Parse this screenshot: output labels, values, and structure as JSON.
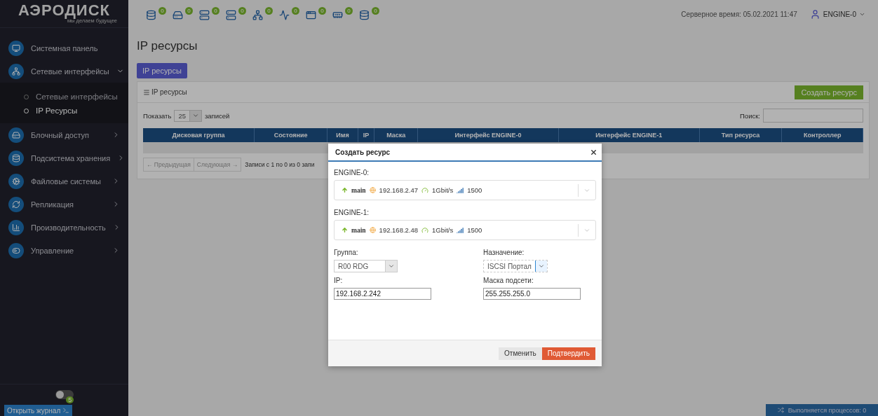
{
  "brand": {
    "name": "АЭРОДИСК",
    "tagline": "мы делаем будущее"
  },
  "status_icons": [
    {
      "kind": "database",
      "count": "0"
    },
    {
      "kind": "disk",
      "count": "0"
    },
    {
      "kind": "server",
      "count": "0"
    },
    {
      "kind": "server",
      "count": "0"
    },
    {
      "kind": "network",
      "count": "0"
    },
    {
      "kind": "pulse",
      "count": "0"
    },
    {
      "kind": "window",
      "count": "0"
    },
    {
      "kind": "memory",
      "count": "0"
    },
    {
      "kind": "database",
      "count": "0"
    }
  ],
  "header": {
    "server_time": "Серверное время: 05.02.2021 11:47",
    "user": "ENGINE-0"
  },
  "sidebar": {
    "items": [
      {
        "kind": "link",
        "label": "Системная панель"
      },
      {
        "kind": "group",
        "label": "Сетевые интерфейсы",
        "expanded": true,
        "children": [
          {
            "label": "Сетевые интерфейсы",
            "selected": false
          },
          {
            "label": "IP Ресурсы",
            "selected": true
          }
        ]
      },
      {
        "kind": "group",
        "label": "Блочный доступ",
        "expanded": false
      },
      {
        "kind": "group",
        "label": "Подсистема хранения",
        "expanded": false
      },
      {
        "kind": "group",
        "label": "Файловые системы",
        "expanded": false
      },
      {
        "kind": "group",
        "label": "Репликация",
        "expanded": false
      },
      {
        "kind": "group",
        "label": "Производительность",
        "expanded": false
      },
      {
        "kind": "group",
        "label": "Управление",
        "expanded": false
      }
    ],
    "toggle": {
      "on": false
    },
    "journal": {
      "label": "Открыть журнал",
      "count": "5"
    }
  },
  "page": {
    "title": "IP ресурсы",
    "tabs": [
      {
        "label": "IP ресурсы",
        "selected": true
      }
    ],
    "panel": {
      "title": "IP ресурсы",
      "create_button": "Создать ресурс",
      "show_label": "Показать",
      "page_size": "25",
      "entries_label": "записей",
      "search_label": "Поиск:",
      "columns": [
        "Дисковая группа",
        "Состояние",
        "Имя",
        "IP",
        "Маска",
        "Интерфейс ENGINE-0",
        "Интерфейс ENGINE-1",
        "Тип ресурса",
        "Контроллер"
      ],
      "prev": "← Предыдущая",
      "next": "Следующая →",
      "info": "Записи с 1 по 0 из 0 запи"
    }
  },
  "status_bar": "Выполняется процессов: 0",
  "dialog": {
    "title": "Создать ресурс",
    "engines": [
      {
        "label": "ENGINE-0:",
        "name": "main",
        "ip": "192.168.2.47",
        "speed": "1Gbit/s",
        "mtu": "1500"
      },
      {
        "label": "ENGINE-1:",
        "name": "main",
        "ip": "192.168.2.48",
        "speed": "1Gbit/s",
        "mtu": "1500"
      }
    ],
    "group": {
      "label": "Группа:",
      "value": "R00 RDG"
    },
    "purpose": {
      "label": "Назначение:",
      "value": "ISCSI Портал"
    },
    "ip": {
      "label": "IP:",
      "value": "192.168.2.242"
    },
    "mask": {
      "label": "Маска подсети:",
      "value": "255.255.255.0"
    },
    "cancel": "Отменить",
    "confirm": "Подтвердить"
  }
}
